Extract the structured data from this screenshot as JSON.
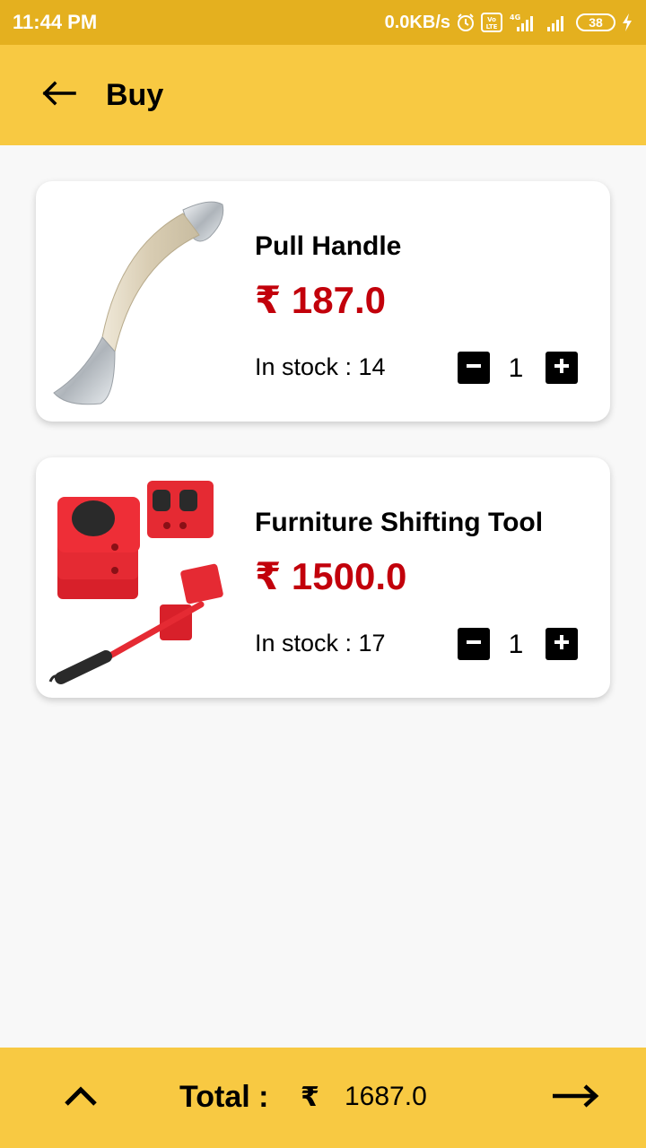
{
  "status_bar": {
    "time": "11:44 PM",
    "net_speed": "0.0KB/s",
    "battery": "38",
    "icons": [
      "alarm-icon",
      "volte-icon",
      "signal-4g-icon",
      "signal-icon",
      "battery-icon",
      "charging-icon"
    ]
  },
  "app_bar": {
    "title": "Buy",
    "back_icon": "arrow-left-icon"
  },
  "products": [
    {
      "name": "Pull Handle",
      "price": "₹ 187.0",
      "stock": "In stock : 14",
      "quantity": "1",
      "image_icon": "pull-handle-image"
    },
    {
      "name": "Furniture Shifting Tool",
      "price": "₹ 1500.0",
      "stock": "In stock : 17",
      "quantity": "1",
      "image_icon": "furniture-shifting-tool-image"
    }
  ],
  "bottom_bar": {
    "total_label": "Total :",
    "currency": "₹",
    "total_value": "1687.0"
  },
  "colors": {
    "status_bar": "#e4b01f",
    "app_bar": "#f8c942",
    "price": "#c2000b",
    "background": "#f8f8f8"
  }
}
